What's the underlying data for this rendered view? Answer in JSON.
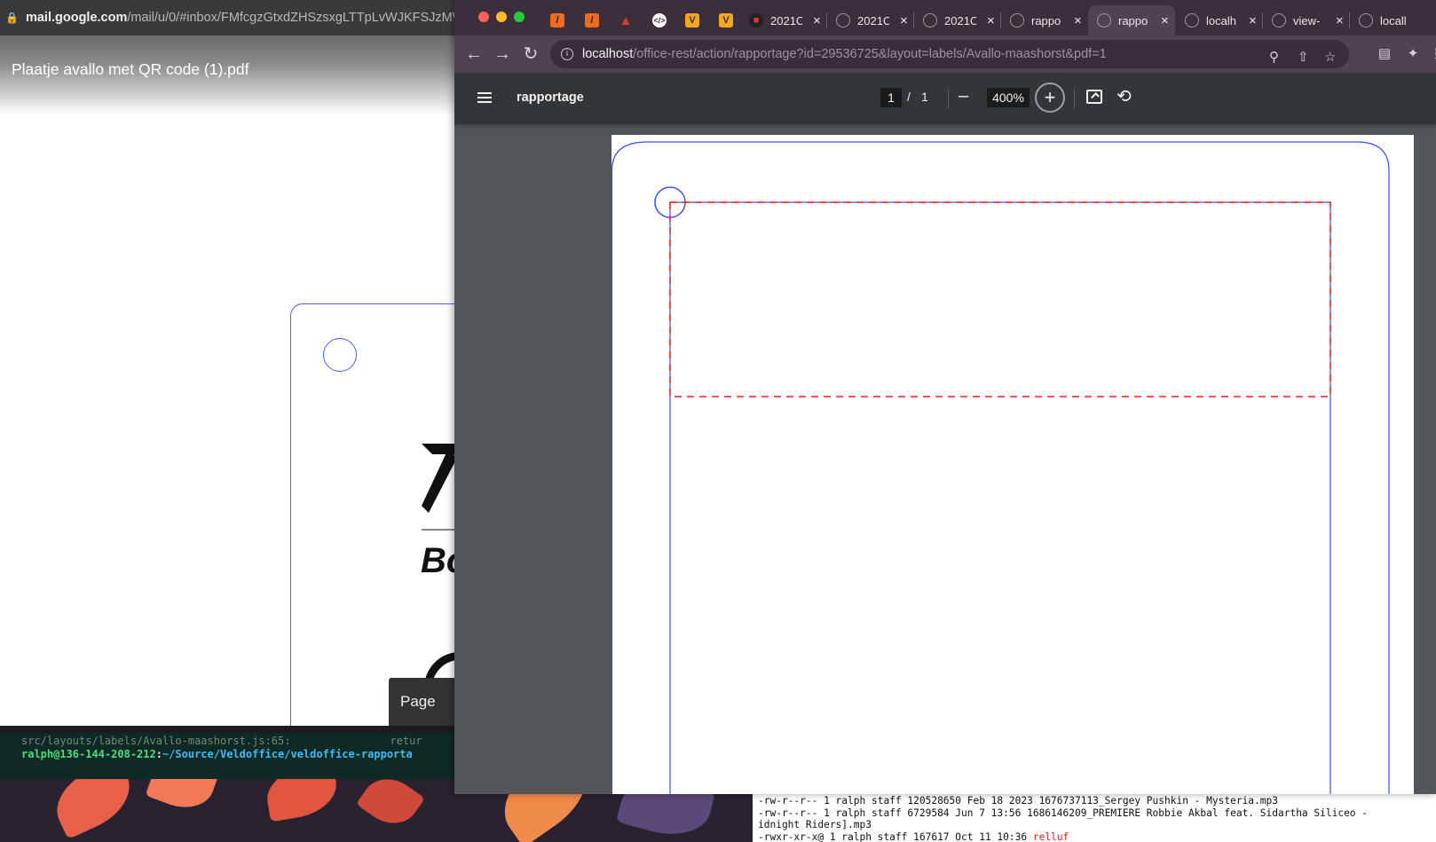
{
  "left_window": {
    "url_host": "mail.google.com",
    "url_rest": "/mail/u/0/#inbox/FMfcgzGtxdZHSzsxgLTTpLvWJKFSJzMW",
    "attachment_title": "Plaatje avallo met QR code (1).pdf",
    "logo_partial_text": "Bo",
    "page_tooltip": "Page"
  },
  "chrome": {
    "tabs": [
      {
        "title": "",
        "favicon": "orange-slash-icon",
        "color": "#f06b1c"
      },
      {
        "title": "",
        "favicon": "orange-slash-icon",
        "color": "#f06b1c"
      },
      {
        "title": "",
        "favicon": "red-wing-icon",
        "color": "#e23a32"
      },
      {
        "title": "",
        "favicon": "code-icon",
        "color": "#ffffff"
      },
      {
        "title": "",
        "favicon": "v-logo-icon",
        "color": "#f5a623"
      },
      {
        "title": "",
        "favicon": "v-logo-icon",
        "color": "#f5a623"
      },
      {
        "title": "2021C",
        "favicon": "ninja-icon",
        "color": "#222222"
      },
      {
        "title": "2021C",
        "favicon": "globe-icon",
        "color": "#9a9a9a"
      },
      {
        "title": "2021C",
        "favicon": "globe-icon",
        "color": "#9a9a9a"
      },
      {
        "title": "rappo",
        "favicon": "globe-icon",
        "color": "#9a9a9a"
      },
      {
        "title": "rappo",
        "favicon": "globe-icon",
        "color": "#9a9a9a",
        "active": true
      },
      {
        "title": "localh",
        "favicon": "globe-icon",
        "color": "#9a9a9a"
      },
      {
        "title": "view-",
        "favicon": "globe-icon",
        "color": "#9a9a9a"
      },
      {
        "title": "locall",
        "favicon": "globe-icon",
        "color": "#9a9a9a"
      }
    ],
    "url_host": "localhost",
    "url_rest": "/office-rest/action/rapportage?id=29536725&layout=labels/Avallo-maashorst&pdf=1"
  },
  "pdf_viewer": {
    "title": "rapportage",
    "current_page": "1",
    "page_separator": "/",
    "total_pages": "1",
    "zoom": "400%"
  },
  "terminal_left": {
    "line1": "src/layouts/labels/Avallo-maashorst.js:65:",
    "line1_suffix": "retur",
    "prompt_user": "ralph@136-144-208-212",
    "prompt_sep": ":",
    "prompt_path": "~/Source/Veldoffice/veldoffice-rapporta"
  },
  "terminal_right": {
    "lines": [
      "-rw-r--r--  1 ralph  staff  120528650 Feb 18  2023 1676737113_Sergey Pushkin - Mysteria.mp3",
      "-rw-r--r--  1 ralph  staff    6729584 Jun  7 13:56 1686146209_PREMIERE Robbie Akbal feat. Sidartha Siliceo -",
      "idnight Riders].mp3"
    ],
    "last_line_prefix": "-rwxr-xr-x@ 1 ralph  staff     167617 Oct 11 10:36 ",
    "last_line_highlight": "relluf"
  }
}
